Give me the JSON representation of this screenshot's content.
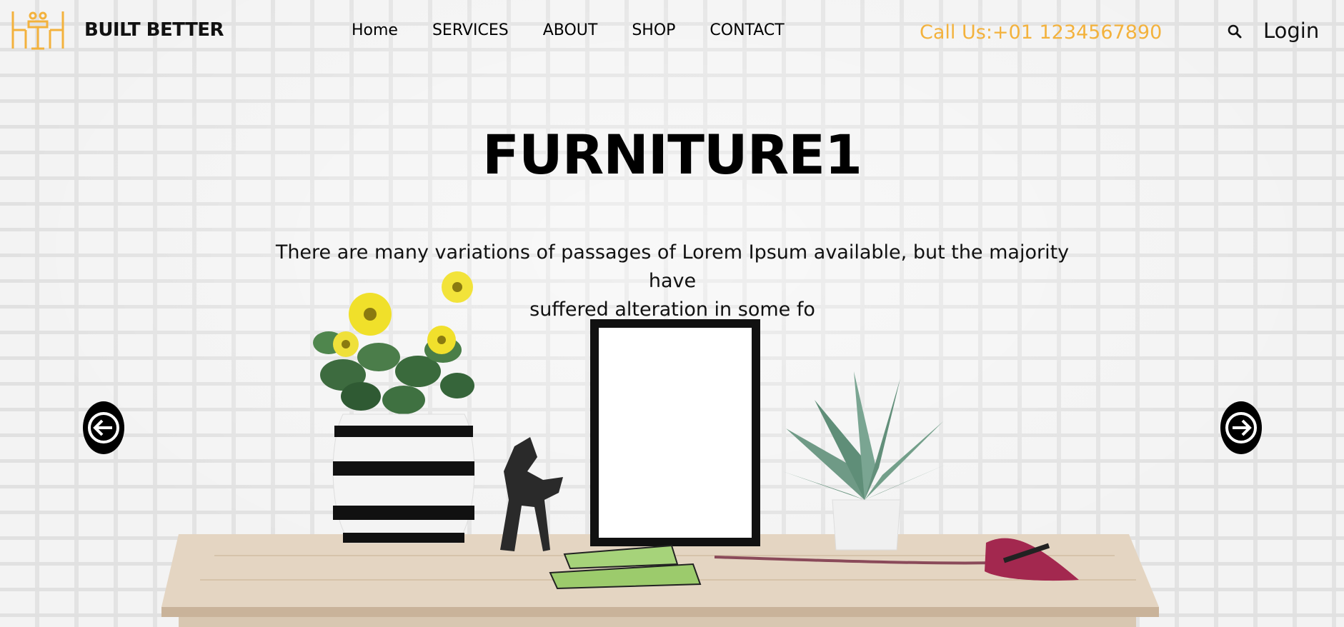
{
  "brand": {
    "name": "BUILT BETTER",
    "logo_icon": "furniture-logo-icon"
  },
  "nav": {
    "items": [
      {
        "label": "Home"
      },
      {
        "label": "SERVICES"
      },
      {
        "label": "ABOUT"
      },
      {
        "label": "SHOP"
      },
      {
        "label": "CONTACT"
      }
    ]
  },
  "header": {
    "call_text": "Call Us:+01 1234567890",
    "search_icon": "search-icon",
    "login_label": "Login"
  },
  "hero": {
    "title": "FURNITURE1",
    "description_line1": "There are many variations of passages of Lorem Ipsum available, but the majority have",
    "description_line2": "suffered alteration in some fo",
    "prev_icon": "arrow-left-icon",
    "next_icon": "arrow-right-icon"
  },
  "colors": {
    "accent": "#f3b23d",
    "text": "#111111",
    "arrow_bg": "#000000"
  }
}
